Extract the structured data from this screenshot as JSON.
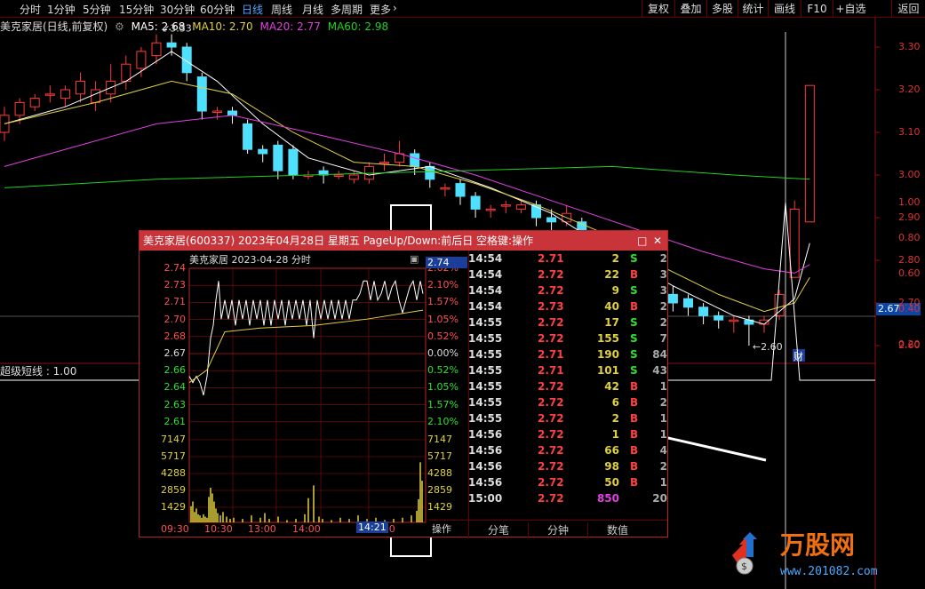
{
  "topbar": {
    "tabs": [
      "分时",
      "1分钟",
      "5分钟",
      "15分钟",
      "30分钟",
      "60分钟",
      "日线",
      "周线",
      "月线",
      "多周期",
      "更多"
    ],
    "active_index": 6,
    "right_buttons": [
      "复权",
      "叠加",
      "多股",
      "统计",
      "画线",
      "F10",
      "+自选",
      "返回"
    ]
  },
  "ma_legend": {
    "title": "美克家居(日线,前复权)",
    "ma5": "MA5: 2.68",
    "ma10": "MA10: 2.70",
    "ma20": "MA20: 2.77",
    "ma60": "MA60: 2.98",
    "colors": {
      "ma5": "#ffffff",
      "ma10": "#e0d040",
      "ma20": "#e040e0",
      "ma60": "#20d020"
    }
  },
  "main_axis": {
    "labels": [
      "3.30",
      "3.20",
      "3.10",
      "3.00",
      "2.90",
      "2.80",
      "2.70",
      "2.60"
    ],
    "current_price": "2.67"
  },
  "annotations": {
    "high": "3.33",
    "low": "2.60",
    "badge": "财"
  },
  "indicator": {
    "title": "超级短线 : 1.00",
    "axis": [
      "1.00",
      "0.80",
      "0.60",
      "0.40",
      "0.20"
    ]
  },
  "candles": [
    [
      3.1,
      3.14,
      3.08,
      3.16
    ],
    [
      3.14,
      3.17,
      3.12,
      3.18
    ],
    [
      3.16,
      3.18,
      3.15,
      3.19
    ],
    [
      3.19,
      3.19,
      3.17,
      3.21
    ],
    [
      3.18,
      3.2,
      3.16,
      3.21
    ],
    [
      3.19,
      3.22,
      3.17,
      3.24
    ],
    [
      3.17,
      3.2,
      3.15,
      3.22
    ],
    [
      3.19,
      3.22,
      3.17,
      3.26
    ],
    [
      3.22,
      3.26,
      3.2,
      3.28
    ],
    [
      3.25,
      3.29,
      3.23,
      3.3
    ],
    [
      3.28,
      3.31,
      3.26,
      3.33
    ],
    [
      3.31,
      3.3,
      3.28,
      3.33
    ],
    [
      3.3,
      3.24,
      3.22,
      3.31
    ],
    [
      3.23,
      3.15,
      3.13,
      3.24
    ],
    [
      3.15,
      3.15,
      3.13,
      3.16
    ],
    [
      3.15,
      3.14,
      3.12,
      3.16
    ],
    [
      3.12,
      3.06,
      3.05,
      3.13
    ],
    [
      3.06,
      3.05,
      3.03,
      3.07
    ],
    [
      3.07,
      3.01,
      2.99,
      3.08
    ],
    [
      3.06,
      3.0,
      2.99,
      3.07
    ],
    [
      3.0,
      3.0,
      2.99,
      3.01
    ],
    [
      3.01,
      3.0,
      2.98,
      3.02
    ],
    [
      3.0,
      3.0,
      2.99,
      3.01
    ],
    [
      2.99,
      3.0,
      2.98,
      3.01
    ],
    [
      2.99,
      3.02,
      2.98,
      3.03
    ],
    [
      3.03,
      3.03,
      3.01,
      3.05
    ],
    [
      3.03,
      3.05,
      3.02,
      3.08
    ],
    [
      3.05,
      3.02,
      3.0,
      3.06
    ],
    [
      3.02,
      2.99,
      2.97,
      3.03
    ],
    [
      2.97,
      2.97,
      2.95,
      2.98
    ],
    [
      2.98,
      2.95,
      2.93,
      2.99
    ],
    [
      2.95,
      2.92,
      2.9,
      2.96
    ],
    [
      2.92,
      2.92,
      2.9,
      2.93
    ],
    [
      2.93,
      2.93,
      2.91,
      2.94
    ],
    [
      2.92,
      2.93,
      2.91,
      2.94
    ],
    [
      2.93,
      2.9,
      2.88,
      2.94
    ],
    [
      2.9,
      2.89,
      2.87,
      2.92
    ],
    [
      2.89,
      2.91,
      2.88,
      2.93
    ],
    [
      2.89,
      2.87,
      2.85,
      2.9
    ],
    [
      2.85,
      2.82,
      2.8,
      2.86
    ],
    [
      2.8,
      2.78,
      2.76,
      2.82
    ],
    [
      2.78,
      2.76,
      2.74,
      2.8
    ],
    [
      2.76,
      2.74,
      2.72,
      2.78
    ],
    [
      2.74,
      2.72,
      2.7,
      2.76
    ],
    [
      2.72,
      2.7,
      2.68,
      2.74
    ],
    [
      2.71,
      2.69,
      2.67,
      2.72
    ],
    [
      2.69,
      2.67,
      2.65,
      2.7
    ],
    [
      2.67,
      2.66,
      2.64,
      2.68
    ],
    [
      2.66,
      2.66,
      2.63,
      2.67
    ],
    [
      2.66,
      2.65,
      2.6,
      2.67
    ],
    [
      2.65,
      2.66,
      2.63,
      2.67
    ],
    [
      2.67,
      2.72,
      2.66,
      2.73
    ],
    [
      2.76,
      2.92,
      2.76,
      2.94
    ],
    [
      2.89,
      3.21,
      2.89,
      3.21
    ]
  ],
  "ma_lines": {
    "ma5": [
      [
        0,
        3.12
      ],
      [
        4,
        3.16
      ],
      [
        8,
        3.22
      ],
      [
        11,
        3.29
      ],
      [
        14,
        3.22
      ],
      [
        17,
        3.12
      ],
      [
        20,
        3.04
      ],
      [
        24,
        3.0
      ],
      [
        28,
        3.02
      ],
      [
        32,
        2.97
      ],
      [
        36,
        2.91
      ],
      [
        40,
        2.82
      ],
      [
        44,
        2.74
      ],
      [
        48,
        2.67
      ],
      [
        50,
        2.65
      ],
      [
        52,
        2.71
      ],
      [
        53,
        2.84
      ]
    ],
    "ma10": [
      [
        0,
        3.12
      ],
      [
        6,
        3.17
      ],
      [
        11,
        3.22
      ],
      [
        15,
        3.19
      ],
      [
        19,
        3.1
      ],
      [
        23,
        3.03
      ],
      [
        27,
        3.02
      ],
      [
        31,
        2.98
      ],
      [
        35,
        2.93
      ],
      [
        39,
        2.87
      ],
      [
        43,
        2.79
      ],
      [
        47,
        2.72
      ],
      [
        50,
        2.68
      ],
      [
        52,
        2.7
      ],
      [
        53,
        2.76
      ]
    ],
    "ma20": [
      [
        0,
        3.02
      ],
      [
        5,
        3.07
      ],
      [
        10,
        3.12
      ],
      [
        15,
        3.14
      ],
      [
        20,
        3.1
      ],
      [
        26,
        3.05
      ],
      [
        31,
        3.0
      ],
      [
        36,
        2.94
      ],
      [
        41,
        2.88
      ],
      [
        46,
        2.82
      ],
      [
        50,
        2.78
      ],
      [
        52,
        2.77
      ],
      [
        53,
        2.79
      ]
    ],
    "ma60": [
      [
        0,
        2.97
      ],
      [
        10,
        2.99
      ],
      [
        20,
        3.0
      ],
      [
        30,
        3.01
      ],
      [
        40,
        3.02
      ],
      [
        48,
        3.0
      ],
      [
        53,
        2.99
      ]
    ]
  },
  "popup": {
    "title": "美克家居(600337) 2023年04月28日 星期五 PageUp/Down:前后日 空格键:操作",
    "window_buttons": [
      "□",
      "✕"
    ],
    "chart_title": "美克家居   2023-04-28 分时",
    "price_labels": [
      "2.74",
      "2.73",
      "2.71",
      "2.70",
      "2.68",
      "2.67",
      "2.66",
      "2.64",
      "2.63",
      "2.61"
    ],
    "pct_labels": [
      "2.62%",
      "2.10%",
      "1.57%",
      "1.05%",
      "0.52%",
      "0.00%",
      "0.52%",
      "1.05%",
      "1.57%",
      "2.10%"
    ],
    "vol_labels": [
      "7147",
      "5717",
      "4288",
      "2859",
      "1429"
    ],
    "time_labels": [
      "09:30",
      "10:30",
      "13:00",
      "14:00",
      "15:00"
    ],
    "cursor_time": "14:21",
    "cursor_price": "2.74",
    "op_label": "操作",
    "ticks": [
      [
        "14:54",
        "2.71",
        "2",
        "S",
        "2"
      ],
      [
        "14:54",
        "2.72",
        "22",
        "B",
        "3"
      ],
      [
        "14:54",
        "2.72",
        "9",
        "S",
        "3"
      ],
      [
        "14:54",
        "2.73",
        "40",
        "B",
        "2"
      ],
      [
        "14:55",
        "2.72",
        "17",
        "S",
        "2"
      ],
      [
        "14:55",
        "2.72",
        "155",
        "S",
        "7"
      ],
      [
        "14:55",
        "2.71",
        "190",
        "S",
        "84"
      ],
      [
        "14:55",
        "2.71",
        "101",
        "S",
        "43"
      ],
      [
        "14:55",
        "2.72",
        "42",
        "B",
        "1"
      ],
      [
        "14:55",
        "2.72",
        "6",
        "B",
        "2"
      ],
      [
        "14:55",
        "2.72",
        "2",
        "B",
        "1"
      ],
      [
        "14:56",
        "2.72",
        "1",
        "B",
        "1"
      ],
      [
        "14:56",
        "2.72",
        "66",
        "B",
        "4"
      ],
      [
        "14:56",
        "2.72",
        "98",
        "B",
        "2"
      ],
      [
        "14:56",
        "2.72",
        "50",
        "B",
        "1"
      ],
      [
        "15:00",
        "2.72",
        "850",
        "",
        "20"
      ]
    ],
    "tabs": [
      "分笔",
      "分钟",
      "数值"
    ]
  },
  "logo": {
    "name": "万股网",
    "url": "www.201082.com"
  }
}
